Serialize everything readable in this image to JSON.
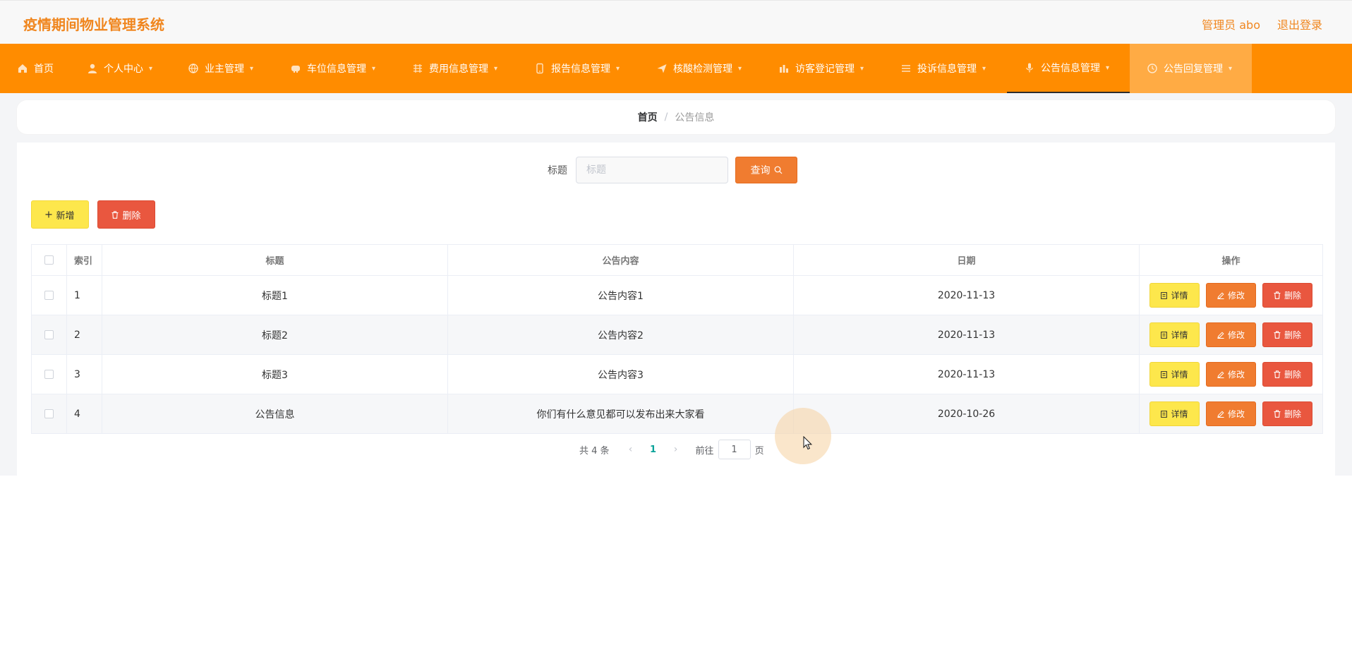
{
  "app": {
    "title": "疫情期间物业管理系统"
  },
  "user": {
    "role_name": "管理员 abo",
    "logout": "退出登录"
  },
  "nav": [
    {
      "label": "首页",
      "icon": "home-icon",
      "dropdown": false
    },
    {
      "label": "个人中心",
      "icon": "user-icon",
      "dropdown": true
    },
    {
      "label": "业主管理",
      "icon": "globe-icon",
      "dropdown": true
    },
    {
      "label": "车位信息管理",
      "icon": "car-icon",
      "dropdown": true
    },
    {
      "label": "费用信息管理",
      "icon": "fee-icon",
      "dropdown": true
    },
    {
      "label": "报告信息管理",
      "icon": "phone-icon",
      "dropdown": true
    },
    {
      "label": "核酸检测管理",
      "icon": "send-icon",
      "dropdown": true
    },
    {
      "label": "访客登记管理",
      "icon": "chart-icon",
      "dropdown": true
    },
    {
      "label": "投诉信息管理",
      "icon": "list-icon",
      "dropdown": true
    },
    {
      "label": "公告信息管理",
      "icon": "mic-icon",
      "dropdown": true
    },
    {
      "label": "公告回复管理",
      "icon": "clock-icon",
      "dropdown": true
    }
  ],
  "breadcrumb": {
    "home": "首页",
    "separator": "/",
    "current": "公告信息"
  },
  "search": {
    "label": "标题",
    "placeholder": "标题",
    "value": "",
    "button": "查询"
  },
  "actions": {
    "add": "新增",
    "delete": "删除"
  },
  "table": {
    "headers": {
      "index": "索引",
      "title": "标题",
      "content": "公告内容",
      "date": "日期",
      "ops": "操作"
    },
    "rows": [
      {
        "index": "1",
        "title": "标题1",
        "content": "公告内容1",
        "date": "2020-11-13"
      },
      {
        "index": "2",
        "title": "标题2",
        "content": "公告内容2",
        "date": "2020-11-13"
      },
      {
        "index": "3",
        "title": "标题3",
        "content": "公告内容3",
        "date": "2020-11-13"
      },
      {
        "index": "4",
        "title": "公告信息",
        "content": "你们有什么意见都可以发布出来大家看",
        "date": "2020-10-26"
      }
    ],
    "row_ops": {
      "detail": "详情",
      "edit": "修改",
      "delete": "删除"
    }
  },
  "pager": {
    "total": "共 4 条",
    "prev": "‹",
    "page": "1",
    "next": "›",
    "goto_prefix": "前往",
    "goto_value": "1",
    "goto_suffix": "页"
  },
  "colors": {
    "accent": "#ff8c00",
    "title": "#f0861e",
    "yellow": "#fde74c",
    "orange": "#f07c30",
    "red": "#e9573f",
    "page_num": "#0ba39a"
  }
}
